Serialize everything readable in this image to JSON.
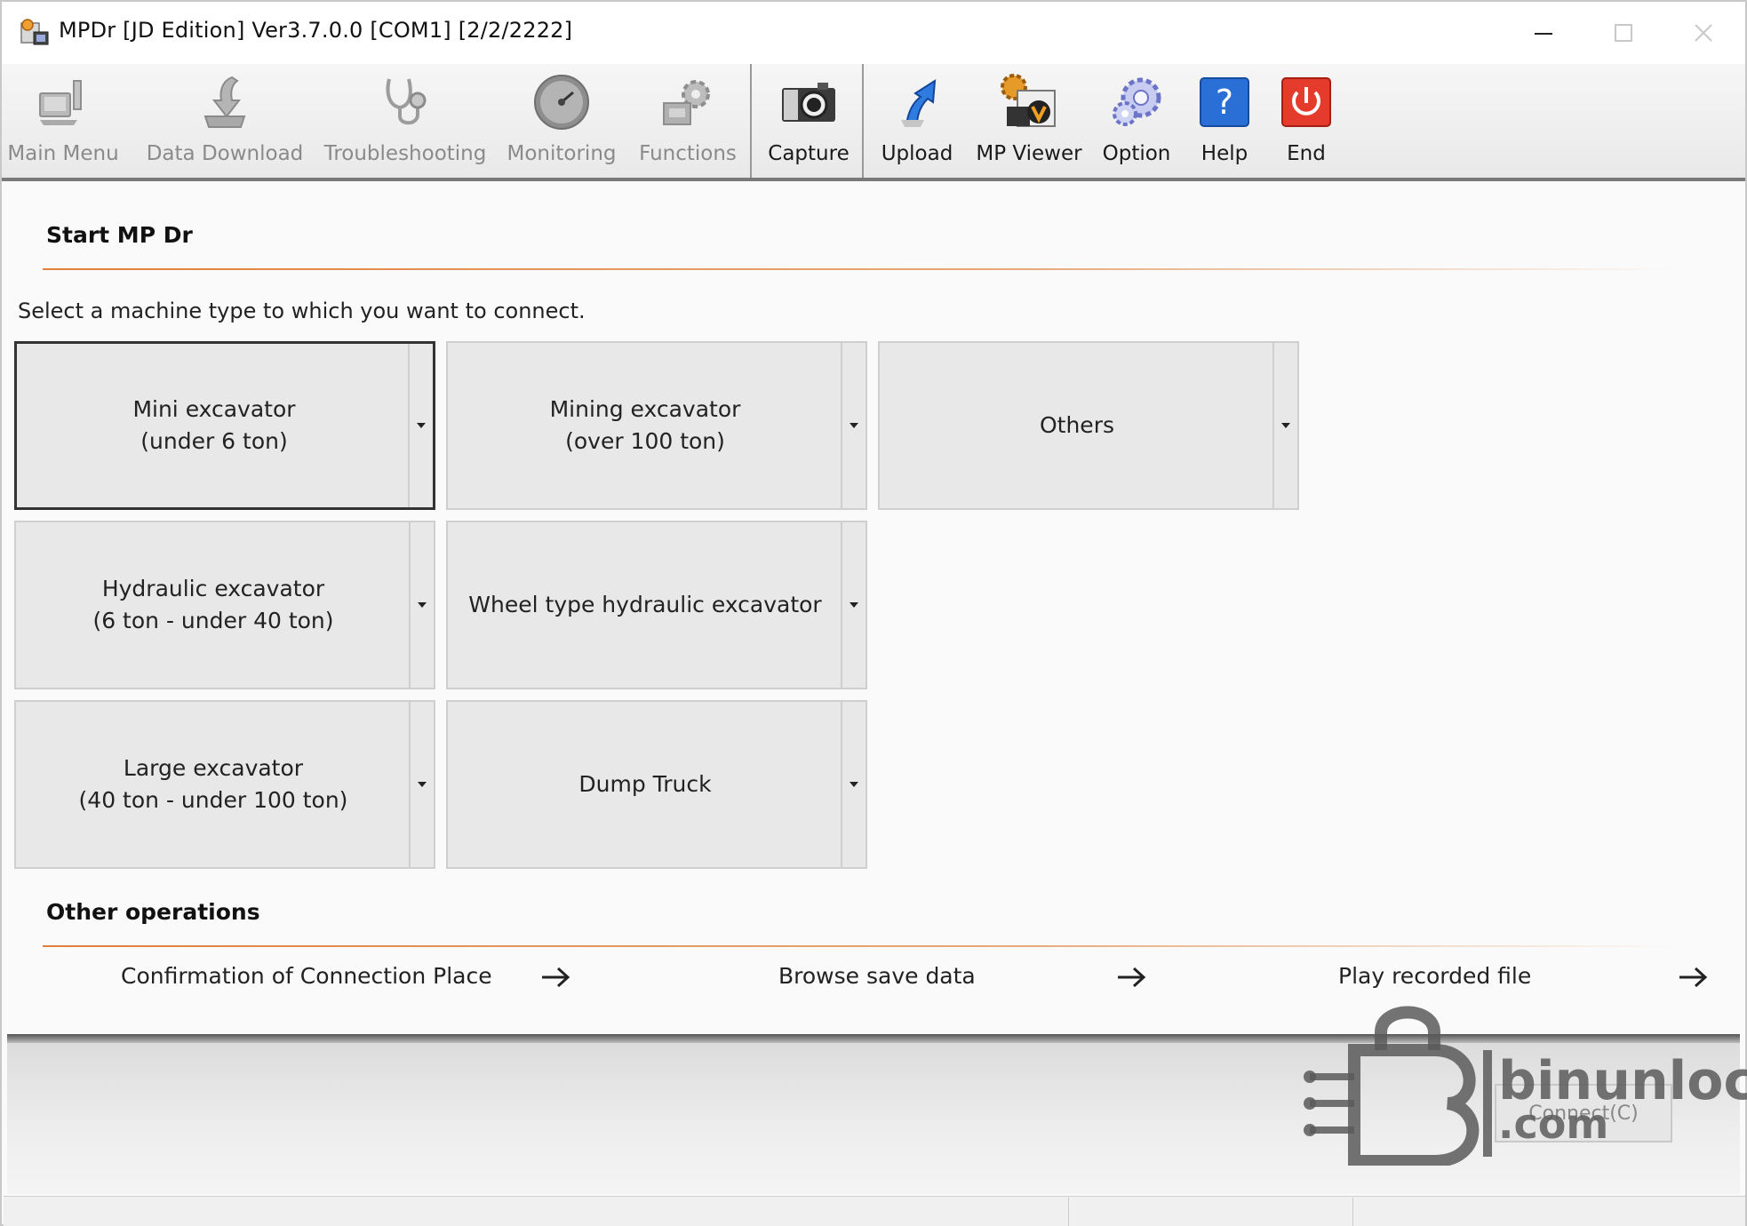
{
  "window": {
    "title": "MPDr [JD Edition] Ver3.7.0.0 [COM1] [2/2/2222]"
  },
  "toolbar": {
    "buttons": [
      {
        "label": "Main Menu",
        "icon": "computer-icon",
        "enabled": false
      },
      {
        "label": "Data Download",
        "icon": "download-arrow-icon",
        "enabled": false
      },
      {
        "label": "Troubleshooting",
        "icon": "stethoscope-icon",
        "enabled": false
      },
      {
        "label": "Monitoring",
        "icon": "gauge-icon",
        "enabled": false
      },
      {
        "label": "Functions",
        "icon": "gears-icon",
        "enabled": false
      },
      {
        "label": "Capture",
        "icon": "camera-icon",
        "enabled": true
      },
      {
        "label": "Upload",
        "icon": "upload-arrow-icon",
        "enabled": true
      },
      {
        "label": "MP Viewer",
        "icon": "mp-viewer-icon",
        "enabled": true
      },
      {
        "label": "Option",
        "icon": "option-gear-icon",
        "enabled": true
      },
      {
        "label": "Help",
        "icon": "help-icon",
        "enabled": true
      },
      {
        "label": "End",
        "icon": "power-icon",
        "enabled": true
      }
    ]
  },
  "start": {
    "title": "Start MP Dr",
    "instruction": "Select a machine type to which you want to connect."
  },
  "machines": [
    {
      "line1": "Mini excavator",
      "line2": "(under 6 ton)",
      "selected": true
    },
    {
      "line1": "Mining excavator",
      "line2": "(over 100 ton)",
      "selected": false
    },
    {
      "line1": "Others",
      "line2": "",
      "selected": false
    },
    {
      "line1": "Hydraulic excavator",
      "line2": "(6 ton - under 40 ton)",
      "selected": false
    },
    {
      "line1": "Wheel type hydraulic excavator",
      "line2": "",
      "selected": false
    },
    {
      "line1": "Large excavator",
      "line2": "(40 ton - under 100 ton)",
      "selected": false
    },
    {
      "line1": "Dump Truck",
      "line2": "",
      "selected": false
    }
  ],
  "other_ops": {
    "title": "Other operations",
    "links": [
      {
        "label": "Confirmation of Connection Place"
      },
      {
        "label": "Browse save data"
      },
      {
        "label": "Play recorded file"
      }
    ]
  },
  "bottom": {
    "connect_label": "Connect(C)"
  },
  "watermark": {
    "text_line1": "binunlock",
    "text_line2": ".com"
  },
  "colors": {
    "accent_line": "#e07f3a",
    "end_button": "#e53b2c",
    "help_button": "#2a6fd6"
  }
}
